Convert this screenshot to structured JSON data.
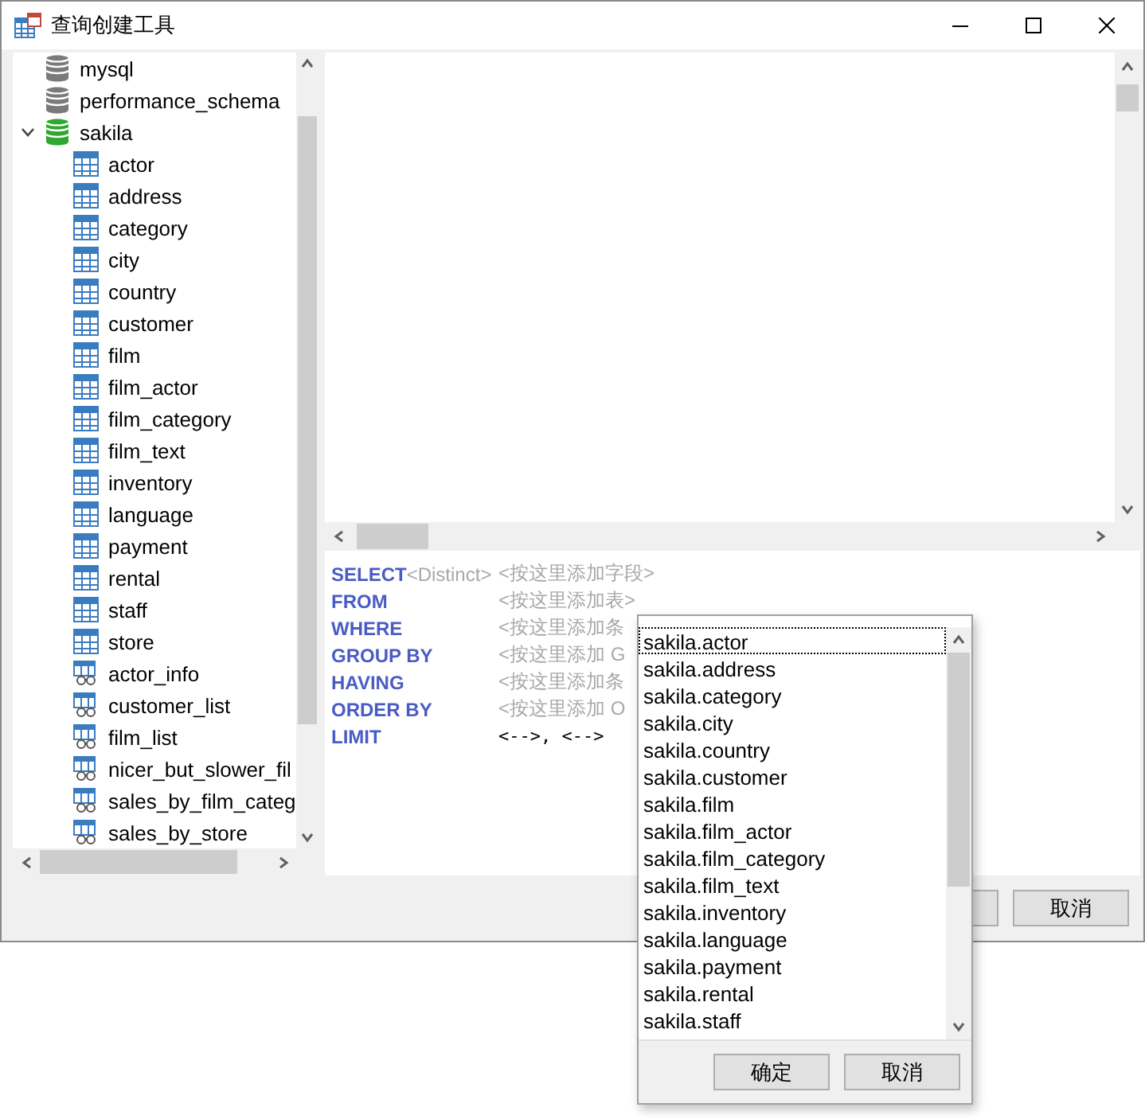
{
  "window": {
    "title": "查询创建工具"
  },
  "tree": {
    "items": [
      {
        "label": "mysql",
        "kind": "database",
        "expanded": false
      },
      {
        "label": "performance_schema",
        "kind": "database",
        "expanded": false
      },
      {
        "label": "sakila",
        "kind": "database",
        "expanded": true,
        "children": [
          {
            "label": "actor",
            "kind": "table"
          },
          {
            "label": "address",
            "kind": "table"
          },
          {
            "label": "category",
            "kind": "table"
          },
          {
            "label": "city",
            "kind": "table"
          },
          {
            "label": "country",
            "kind": "table"
          },
          {
            "label": "customer",
            "kind": "table"
          },
          {
            "label": "film",
            "kind": "table"
          },
          {
            "label": "film_actor",
            "kind": "table"
          },
          {
            "label": "film_category",
            "kind": "table"
          },
          {
            "label": "film_text",
            "kind": "table"
          },
          {
            "label": "inventory",
            "kind": "table"
          },
          {
            "label": "language",
            "kind": "table"
          },
          {
            "label": "payment",
            "kind": "table"
          },
          {
            "label": "rental",
            "kind": "table"
          },
          {
            "label": "staff",
            "kind": "table"
          },
          {
            "label": "store",
            "kind": "table"
          },
          {
            "label": "actor_info",
            "kind": "view"
          },
          {
            "label": "customer_list",
            "kind": "view"
          },
          {
            "label": "film_list",
            "kind": "view"
          },
          {
            "label": "nicer_but_slower_fil",
            "kind": "view"
          },
          {
            "label": "sales_by_film_categ",
            "kind": "view"
          },
          {
            "label": "sales_by_store",
            "kind": "view"
          }
        ]
      }
    ]
  },
  "sql": {
    "clauses": [
      {
        "keyword": "SELECT",
        "options": "<Distinct>",
        "hint": "<按这里添加字段>"
      },
      {
        "keyword": "FROM",
        "hint": "<按这里添加表>"
      },
      {
        "keyword": "WHERE",
        "hint": "<按这里添加条"
      },
      {
        "keyword": "GROUP BY",
        "hint": "<按这里添加 G"
      },
      {
        "keyword": "HAVING",
        "hint": "<按这里添加条"
      },
      {
        "keyword": "ORDER BY",
        "hint": "<按这里添加 O"
      },
      {
        "keyword": "LIMIT",
        "value": "<-->, <-->"
      }
    ]
  },
  "buttons": [
    {
      "label": "取消"
    }
  ],
  "popup": {
    "items": [
      {
        "label": "sakila.actor",
        "selected": true
      },
      {
        "label": "sakila.address",
        "selected": false
      },
      {
        "label": "sakila.category",
        "selected": false
      },
      {
        "label": "sakila.city",
        "selected": false
      },
      {
        "label": "sakila.country",
        "selected": false
      },
      {
        "label": "sakila.customer",
        "selected": false
      },
      {
        "label": "sakila.film",
        "selected": false
      },
      {
        "label": "sakila.film_actor",
        "selected": false
      },
      {
        "label": "sakila.film_category",
        "selected": false
      },
      {
        "label": "sakila.film_text",
        "selected": false
      },
      {
        "label": "sakila.inventory",
        "selected": false
      },
      {
        "label": "sakila.language",
        "selected": false
      },
      {
        "label": "sakila.payment",
        "selected": false
      },
      {
        "label": "sakila.rental",
        "selected": false
      },
      {
        "label": "sakila.staff",
        "selected": false
      }
    ],
    "buttons": [
      {
        "label": "确定"
      },
      {
        "label": "取消"
      }
    ]
  }
}
